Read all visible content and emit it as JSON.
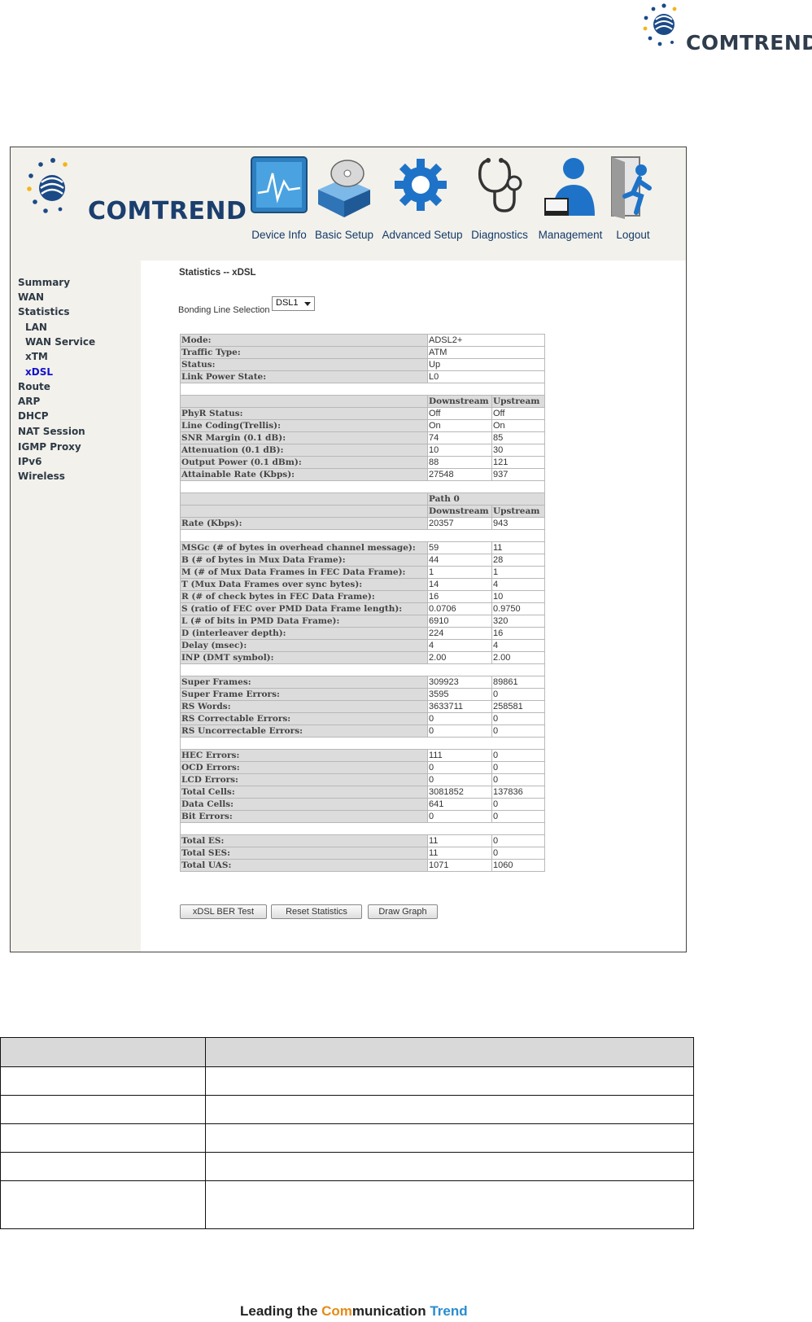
{
  "brand_name": "COMTREND",
  "nav": [
    {
      "label": "Device Info",
      "icon": "chart-monitor-icon"
    },
    {
      "label": "Basic Setup",
      "icon": "disk-box-icon"
    },
    {
      "label": "Advanced Setup",
      "icon": "gear-icon"
    },
    {
      "label": "Diagnostics",
      "icon": "stethoscope-icon"
    },
    {
      "label": "Management",
      "icon": "user-laptop-icon"
    },
    {
      "label": "Logout",
      "icon": "exit-door-icon"
    }
  ],
  "sidebar": [
    {
      "label": "Summary"
    },
    {
      "label": "WAN"
    },
    {
      "label": "Statistics"
    },
    {
      "label": "LAN"
    },
    {
      "label": "WAN Service"
    },
    {
      "label": "xTM"
    },
    {
      "label": "xDSL"
    },
    {
      "label": "Route"
    },
    {
      "label": "ARP"
    },
    {
      "label": "DHCP"
    },
    {
      "label": "NAT Session"
    },
    {
      "label": "IGMP Proxy"
    },
    {
      "label": "IPv6"
    },
    {
      "label": "Wireless"
    }
  ],
  "page": {
    "title": "Statistics -- xDSL",
    "bonding_label": "Bonding Line Selection",
    "bonding_value": "DSL1"
  },
  "stats": {
    "mode": {
      "label": "Mode:",
      "value": "ADSL2+"
    },
    "traffic_type": {
      "label": "Traffic Type:",
      "value": "ATM"
    },
    "status": {
      "label": "Status:",
      "value": "Up"
    },
    "link_power": {
      "label": "Link Power State:",
      "value": "L0"
    },
    "col_down": "Downstream",
    "col_up": "Upstream",
    "path": "Path 0",
    "phy_rows": [
      {
        "label": "PhyR Status:",
        "down": "Off",
        "up": "Off"
      },
      {
        "label": "Line Coding(Trellis):",
        "down": "On",
        "up": "On"
      },
      {
        "label": "SNR Margin (0.1 dB):",
        "down": "74",
        "up": "85"
      },
      {
        "label": "Attenuation (0.1 dB):",
        "down": "10",
        "up": "30"
      },
      {
        "label": "Output Power (0.1 dBm):",
        "down": "88",
        "up": "121"
      },
      {
        "label": "Attainable Rate (Kbps):",
        "down": "27548",
        "up": "937"
      }
    ],
    "rate": {
      "label": "Rate (Kbps):",
      "down": "20357",
      "up": "943"
    },
    "frame_rows": [
      {
        "label": "MSGc (# of bytes in overhead channel message):",
        "down": "59",
        "up": "11"
      },
      {
        "label": "B (# of bytes in Mux Data Frame):",
        "down": "44",
        "up": "28"
      },
      {
        "label": "M (# of Mux Data Frames in FEC Data Frame):",
        "down": "1",
        "up": "1"
      },
      {
        "label": "T (Mux Data Frames over sync bytes):",
        "down": "14",
        "up": "4"
      },
      {
        "label": "R (# of check bytes in FEC Data Frame):",
        "down": "16",
        "up": "10"
      },
      {
        "label": "S (ratio of FEC over PMD Data Frame length):",
        "down": "0.0706",
        "up": "0.9750"
      },
      {
        "label": "L (# of bits in PMD Data Frame):",
        "down": "6910",
        "up": "320"
      },
      {
        "label": "D (interleaver depth):",
        "down": "224",
        "up": "16"
      },
      {
        "label": "Delay (msec):",
        "down": "4",
        "up": "4"
      },
      {
        "label": "INP (DMT symbol):",
        "down": "2.00",
        "up": "2.00"
      }
    ],
    "sf_rows": [
      {
        "label": "Super Frames:",
        "down": "309923",
        "up": "89861"
      },
      {
        "label": "Super Frame Errors:",
        "down": "3595",
        "up": "0"
      },
      {
        "label": "RS Words:",
        "down": "3633711",
        "up": "258581"
      },
      {
        "label": "RS Correctable Errors:",
        "down": "0",
        "up": "0"
      },
      {
        "label": "RS Uncorrectable Errors:",
        "down": "0",
        "up": "0"
      }
    ],
    "err_rows": [
      {
        "label": "HEC Errors:",
        "down": "111",
        "up": "0"
      },
      {
        "label": "OCD Errors:",
        "down": "0",
        "up": "0"
      },
      {
        "label": "LCD Errors:",
        "down": "0",
        "up": "0"
      },
      {
        "label": "Total Cells:",
        "down": "3081852",
        "up": "137836"
      },
      {
        "label": "Data Cells:",
        "down": "641",
        "up": "0"
      },
      {
        "label": "Bit Errors:",
        "down": "0",
        "up": "0"
      }
    ],
    "total_rows": [
      {
        "label": "Total ES:",
        "down": "11",
        "up": "0"
      },
      {
        "label": "Total SES:",
        "down": "11",
        "up": "0"
      },
      {
        "label": "Total UAS:",
        "down": "1071",
        "up": "1060"
      }
    ]
  },
  "buttons": {
    "ber_test": "xDSL BER Test",
    "reset": "Reset Statistics",
    "graph": "Draw Graph"
  },
  "footer": {
    "part1": "Leading the ",
    "part2": "Com",
    "part3": "munication ",
    "part4": "Trend"
  },
  "colors": {
    "nav_text": "#123a6a",
    "active_link": "#1111cc",
    "frame_bg": "#f3f1eb",
    "label_cell": "#dcdcdc",
    "footer_accent_orange": "#e58b16",
    "footer_accent_blue": "#2a8ccf"
  }
}
